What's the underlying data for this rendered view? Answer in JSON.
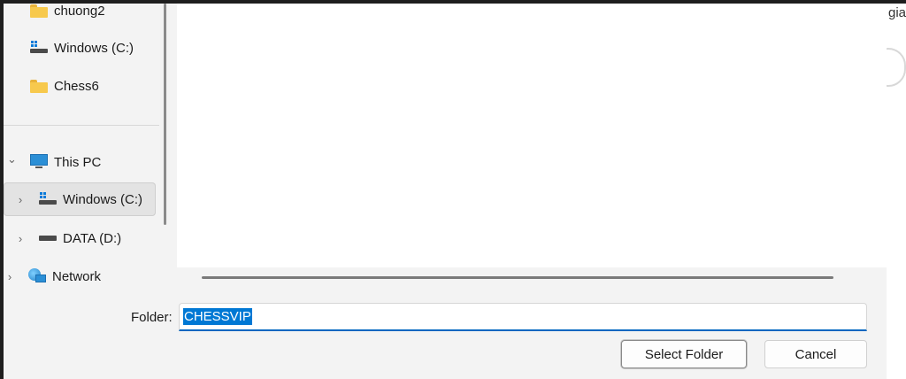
{
  "dialog": {
    "nav": {
      "items": [
        {
          "label": "chuong2",
          "icon": "folder-icon"
        },
        {
          "label": "Windows (C:)",
          "icon": "drive-icon"
        },
        {
          "label": "Chess6",
          "icon": "folder-icon"
        },
        {
          "label": "This PC",
          "icon": "pc-icon",
          "expanded": true
        },
        {
          "label": "Windows (C:)",
          "icon": "drive-icon",
          "selected": true
        },
        {
          "label": "DATA (D:)",
          "icon": "hdd-icon"
        },
        {
          "label": "Network",
          "icon": "network-icon"
        }
      ],
      "chevron_expanded": "⌄",
      "chevron_collapsed": "›"
    },
    "footer": {
      "folder_label": "Folder:",
      "folder_value": "CHESSVIP",
      "select_button": "Select Folder",
      "cancel_button": "Cancel"
    }
  },
  "background_window": {
    "partial_text": "gia"
  },
  "colors": {
    "accent": "#0078d4",
    "folder": "#f7c94d",
    "selection": "#e3e3e3"
  }
}
